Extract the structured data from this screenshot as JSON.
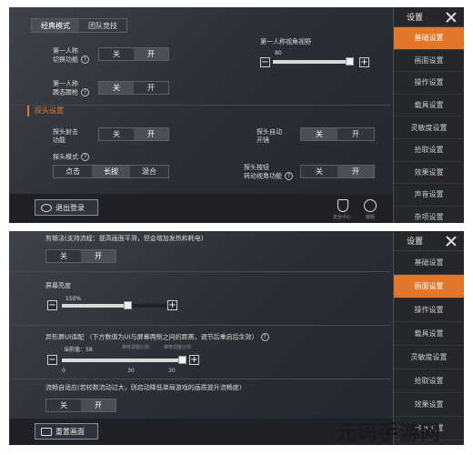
{
  "panel1": {
    "sidebar": {
      "title": "设置",
      "items": [
        "基础设置",
        "画面设置",
        "操作设置",
        "载具设置",
        "灵敏度设置",
        "拾取设置",
        "效果设置",
        "声音设置",
        "杂项设置"
      ],
      "active_index": 0
    },
    "tabs": [
      "经典模式",
      "团队竞技"
    ],
    "active_tab": 0,
    "first_person_switch": {
      "label": "第一人称\n切换功能",
      "off": "关",
      "on": "开",
      "selected": "on"
    },
    "first_person_fov": {
      "label": "第一人称视角视野",
      "value_label": "80",
      "level": 0.93
    },
    "first_person_follow": {
      "label": "第一人称\n跟态跟枪",
      "off": "关",
      "on": "开",
      "selected": "off"
    },
    "section_peek": "探头设置",
    "peek_shoot": {
      "label": "探头射击\n功能",
      "off": "关",
      "on": "开",
      "selected": "on"
    },
    "peek_auto_scope": {
      "label": "探头自动\n开镜",
      "off": "关",
      "on": "开",
      "selected": "off"
    },
    "peek_mode": {
      "label": "探头模式",
      "options": [
        "点击",
        "长按",
        "混合"
      ],
      "selected": 1
    },
    "peek_rotate": {
      "label": "探头按钮\n转动视角功能",
      "off": "关",
      "on": "开",
      "selected": "on"
    },
    "logout_label": "退出登录",
    "bottom_icons": [
      {
        "name": "shield-icon",
        "label": "安全中心"
      },
      {
        "name": "headset-icon",
        "label": "客服"
      }
    ]
  },
  "panel2": {
    "sidebar": {
      "title": "设置",
      "items": [
        "基础设置",
        "画面设置",
        "操作设置",
        "载具设置",
        "灵敏度设置",
        "拾取设置",
        "效果设置",
        "声音设置"
      ],
      "active_index": 1
    },
    "frame_desc": "剪辑法(支持流程：提高画面平滑，但会增加发热和耗电)",
    "frame_toggle": {
      "off": "关",
      "on": "开",
      "selected": "on"
    },
    "brightness": {
      "label": "屏幕亮度",
      "value_label": "150%",
      "level": 0.6
    },
    "fullscreen": {
      "label": "异形屏UI适配",
      "desc": "（下方数值为UI与屏幕两侧之间的距离，调节后重启后生效）",
      "current": "当前值：58",
      "marker_a": "推荐调整比例",
      "marker_b": "推荐调整比例",
      "ticks": [
        "0",
        "30",
        "30"
      ],
      "level": 0.97
    },
    "smooth_mode": {
      "label": "流畅自适应(若较数流动过大，则启动降低单局游戏的画质提升流畅度)",
      "off": "关",
      "on": "开",
      "selected": "on"
    },
    "reset_label": "重置画面"
  },
  "watermark": "元码手游网"
}
